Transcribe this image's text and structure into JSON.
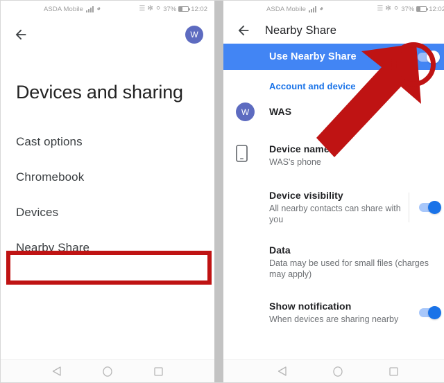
{
  "status_bar": {
    "carrier": "ASDA Mobile",
    "signal_icon": "signal-bars-icon",
    "wifi_icon": "wifi-icon",
    "nfc_icon": "nfc-icon",
    "bluetooth_icon": "bluetooth-icon",
    "alarm_icon": "vibrate-off-icon",
    "battery_percent": "37%",
    "battery_icon": "battery-icon",
    "time": "12:02"
  },
  "left_screen": {
    "back_icon": "back-arrow-icon",
    "avatar_initial": "W",
    "title": "Devices and sharing",
    "menu": [
      {
        "label": "Cast options"
      },
      {
        "label": "Chromebook"
      },
      {
        "label": "Devices"
      },
      {
        "label": "Nearby Share"
      }
    ],
    "highlight_color": "#bf1313"
  },
  "right_screen": {
    "back_icon": "back-arrow-icon",
    "title": "Nearby Share",
    "master_toggle": {
      "label": "Use Nearby Share",
      "state": "on",
      "band_color": "#4285f4"
    },
    "section_link": "Account and device",
    "account": {
      "avatar_initial": "W",
      "name": "WAS"
    },
    "rows": [
      {
        "icon": "phone-icon",
        "title": "Device name",
        "subtitle": "WAS's phone",
        "has_toggle": false
      },
      {
        "icon": "",
        "title": "Device visibility",
        "subtitle": "All nearby contacts can share with you",
        "has_toggle": true,
        "toggle_state": "on"
      },
      {
        "icon": "",
        "title": "Data",
        "subtitle": "Data may be used for small files (charges may apply)",
        "has_toggle": false
      },
      {
        "icon": "",
        "title": "Show notification",
        "subtitle": "When devices are sharing nearby",
        "has_toggle": true,
        "toggle_state": "on"
      }
    ],
    "annotations": {
      "ring_color": "#bf1313",
      "arrow_color": "#bf1313"
    }
  },
  "nav_bar": {
    "back_icon": "nav-back-triangle-icon",
    "home_icon": "nav-home-circle-icon",
    "recents_icon": "nav-recents-square-icon"
  }
}
